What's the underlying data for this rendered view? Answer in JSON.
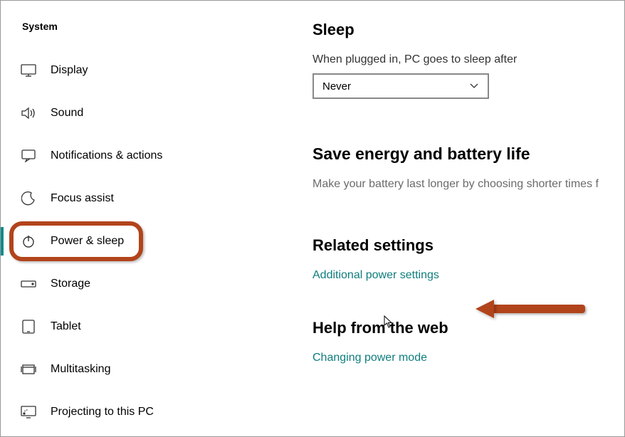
{
  "sidebar": {
    "title": "System",
    "items": [
      {
        "label": "Display"
      },
      {
        "label": "Sound"
      },
      {
        "label": "Notifications & actions"
      },
      {
        "label": "Focus assist"
      },
      {
        "label": "Power & sleep"
      },
      {
        "label": "Storage"
      },
      {
        "label": "Tablet"
      },
      {
        "label": "Multitasking"
      },
      {
        "label": "Projecting to this PC"
      }
    ]
  },
  "main": {
    "sleep": {
      "heading": "Sleep",
      "label": "When plugged in, PC goes to sleep after",
      "selected": "Never"
    },
    "energy": {
      "heading": "Save energy and battery life",
      "body": "Make your battery last longer by choosing shorter times f"
    },
    "related": {
      "heading": "Related settings",
      "link": "Additional power settings"
    },
    "help": {
      "heading": "Help from the web",
      "link": "Changing power mode"
    }
  }
}
